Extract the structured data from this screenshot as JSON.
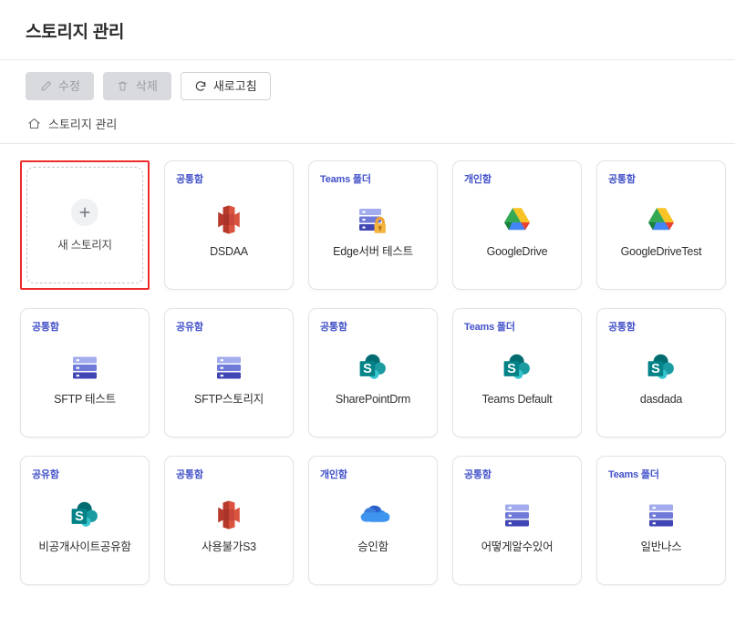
{
  "header": {
    "title": "스토리지 관리"
  },
  "toolbar": {
    "edit_label": "수정",
    "delete_label": "삭제",
    "refresh_label": "새로고침"
  },
  "breadcrumb": {
    "home_label": "스토리지 관리"
  },
  "new_card": {
    "label": "새 스토리지"
  },
  "accent": {
    "badge_color": "#4251c9",
    "selection_color": "#ef2b2b"
  },
  "cards": [
    {
      "badge": "공통함",
      "name": "DSDAA",
      "icon": "aws-s3-icon"
    },
    {
      "badge": "Teams 폴더",
      "name": "Edge서버 테스트",
      "icon": "server-lock-icon"
    },
    {
      "badge": "개인함",
      "name": "GoogleDrive",
      "icon": "google-drive-icon"
    },
    {
      "badge": "공통함",
      "name": "GoogleDriveTest",
      "icon": "google-drive-icon"
    },
    {
      "badge": "공통함",
      "name": "SFTP 테스트",
      "icon": "server-icon"
    },
    {
      "badge": "공유함",
      "name": "SFTP스토리지",
      "icon": "server-icon"
    },
    {
      "badge": "공통함",
      "name": "SharePointDrm",
      "icon": "sharepoint-icon"
    },
    {
      "badge": "Teams 폴더",
      "name": "Teams Default",
      "icon": "sharepoint-icon"
    },
    {
      "badge": "공통함",
      "name": "dasdada",
      "icon": "sharepoint-icon"
    },
    {
      "badge": "공유함",
      "name": "비공개사이트공유함",
      "icon": "sharepoint-icon"
    },
    {
      "badge": "공통함",
      "name": "사용불가S3",
      "icon": "aws-s3-icon"
    },
    {
      "badge": "개인함",
      "name": "승인함",
      "icon": "onedrive-icon"
    },
    {
      "badge": "공통함",
      "name": "어떻게알수있어",
      "icon": "server-icon"
    },
    {
      "badge": "Teams 폴더",
      "name": "일반나스",
      "icon": "server-icon"
    }
  ]
}
